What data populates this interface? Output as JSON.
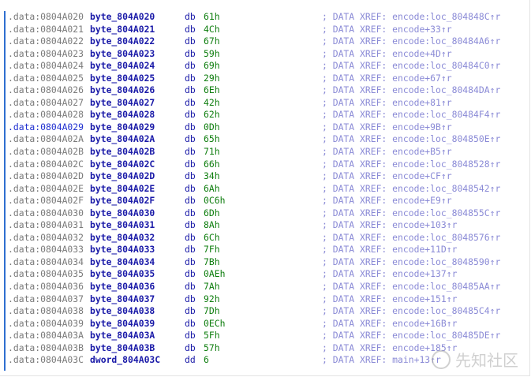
{
  "rows": [
    {
      "addr": ".data:0804A020",
      "label": "byte_804A020",
      "mnemonic": "db",
      "value": "61h",
      "comment": "; DATA XREF: encode:loc_804848C↑r"
    },
    {
      "addr": ".data:0804A021",
      "label": "byte_804A021",
      "mnemonic": "db",
      "value": "4Ch",
      "comment": "; DATA XREF: encode+33↑r"
    },
    {
      "addr": ".data:0804A022",
      "label": "byte_804A022",
      "mnemonic": "db",
      "value": "67h",
      "comment": "; DATA XREF: encode:loc_80484A6↑r"
    },
    {
      "addr": ".data:0804A023",
      "label": "byte_804A023",
      "mnemonic": "db",
      "value": "59h",
      "comment": "; DATA XREF: encode+4D↑r"
    },
    {
      "addr": ".data:0804A024",
      "label": "byte_804A024",
      "mnemonic": "db",
      "value": "69h",
      "comment": "; DATA XREF: encode:loc_80484C0↑r"
    },
    {
      "addr": ".data:0804A025",
      "label": "byte_804A025",
      "mnemonic": "db",
      "value": "29h",
      "comment": "; DATA XREF: encode+67↑r"
    },
    {
      "addr": ".data:0804A026",
      "label": "byte_804A026",
      "mnemonic": "db",
      "value": "6Eh",
      "comment": "; DATA XREF: encode:loc_80484DA↑r"
    },
    {
      "addr": ".data:0804A027",
      "label": "byte_804A027",
      "mnemonic": "db",
      "value": "42h",
      "comment": "; DATA XREF: encode+81↑r"
    },
    {
      "addr": ".data:0804A028",
      "label": "byte_804A028",
      "mnemonic": "db",
      "value": "62h",
      "comment": "; DATA XREF: encode:loc_80484F4↑r"
    },
    {
      "addr": ".data:0804A029",
      "label": "byte_804A029",
      "mnemonic": "db",
      "value": "0Dh",
      "comment": "; DATA XREF: encode+9B↑r",
      "highlight": true
    },
    {
      "addr": ".data:0804A02A",
      "label": "byte_804A02A",
      "mnemonic": "db",
      "value": "65h",
      "comment": "; DATA XREF: encode:loc_804850E↑r"
    },
    {
      "addr": ".data:0804A02B",
      "label": "byte_804A02B",
      "mnemonic": "db",
      "value": "71h",
      "comment": "; DATA XREF: encode+B5↑r"
    },
    {
      "addr": ".data:0804A02C",
      "label": "byte_804A02C",
      "mnemonic": "db",
      "value": "66h",
      "comment": "; DATA XREF: encode:loc_8048528↑r"
    },
    {
      "addr": ".data:0804A02D",
      "label": "byte_804A02D",
      "mnemonic": "db",
      "value": "34h",
      "comment": "; DATA XREF: encode+CF↑r"
    },
    {
      "addr": ".data:0804A02E",
      "label": "byte_804A02E",
      "mnemonic": "db",
      "value": "6Ah",
      "comment": "; DATA XREF: encode:loc_8048542↑r"
    },
    {
      "addr": ".data:0804A02F",
      "label": "byte_804A02F",
      "mnemonic": "db",
      "value": "0C6h",
      "comment": "; DATA XREF: encode+E9↑r"
    },
    {
      "addr": ".data:0804A030",
      "label": "byte_804A030",
      "mnemonic": "db",
      "value": "6Dh",
      "comment": "; DATA XREF: encode:loc_804855C↑r"
    },
    {
      "addr": ".data:0804A031",
      "label": "byte_804A031",
      "mnemonic": "db",
      "value": "8Ah",
      "comment": "; DATA XREF: encode+103↑r"
    },
    {
      "addr": ".data:0804A032",
      "label": "byte_804A032",
      "mnemonic": "db",
      "value": "6Ch",
      "comment": "; DATA XREF: encode:loc_8048576↑r"
    },
    {
      "addr": ".data:0804A033",
      "label": "byte_804A033",
      "mnemonic": "db",
      "value": "7Fh",
      "comment": "; DATA XREF: encode+11D↑r"
    },
    {
      "addr": ".data:0804A034",
      "label": "byte_804A034",
      "mnemonic": "db",
      "value": "7Bh",
      "comment": "; DATA XREF: encode:loc_8048590↑r"
    },
    {
      "addr": ".data:0804A035",
      "label": "byte_804A035",
      "mnemonic": "db",
      "value": "0AEh",
      "comment": "; DATA XREF: encode+137↑r"
    },
    {
      "addr": ".data:0804A036",
      "label": "byte_804A036",
      "mnemonic": "db",
      "value": "7Ah",
      "comment": "; DATA XREF: encode:loc_80485AA↑r"
    },
    {
      "addr": ".data:0804A037",
      "label": "byte_804A037",
      "mnemonic": "db",
      "value": "92h",
      "comment": "; DATA XREF: encode+151↑r"
    },
    {
      "addr": ".data:0804A038",
      "label": "byte_804A038",
      "mnemonic": "db",
      "value": "7Dh",
      "comment": "; DATA XREF: encode:loc_80485C4↑r"
    },
    {
      "addr": ".data:0804A039",
      "label": "byte_804A039",
      "mnemonic": "db",
      "value": "0ECh",
      "comment": "; DATA XREF: encode+16B↑r"
    },
    {
      "addr": ".data:0804A03A",
      "label": "byte_804A03A",
      "mnemonic": "db",
      "value": "5Fh",
      "comment": "; DATA XREF: encode:loc_80485DE↑r"
    },
    {
      "addr": ".data:0804A03B",
      "label": "byte_804A03B",
      "mnemonic": "db",
      "value": "57h",
      "comment": "; DATA XREF: encode+185↑r"
    },
    {
      "addr": ".data:0804A03C",
      "label": "dword_804A03C",
      "mnemonic": "dd",
      "value": "6",
      "comment": "; DATA XREF: main+13↑r"
    }
  ],
  "watermark": {
    "text": "先知社区",
    "icon": "xianzhi-logo-icon"
  },
  "colors": {
    "address": "#7a7a7a",
    "address_highlight": "#1f2fd0",
    "label": "#1a1aa8",
    "value": "#0d7d0d",
    "comment": "#8a8ad6",
    "gutter": "#2f6fd0"
  }
}
